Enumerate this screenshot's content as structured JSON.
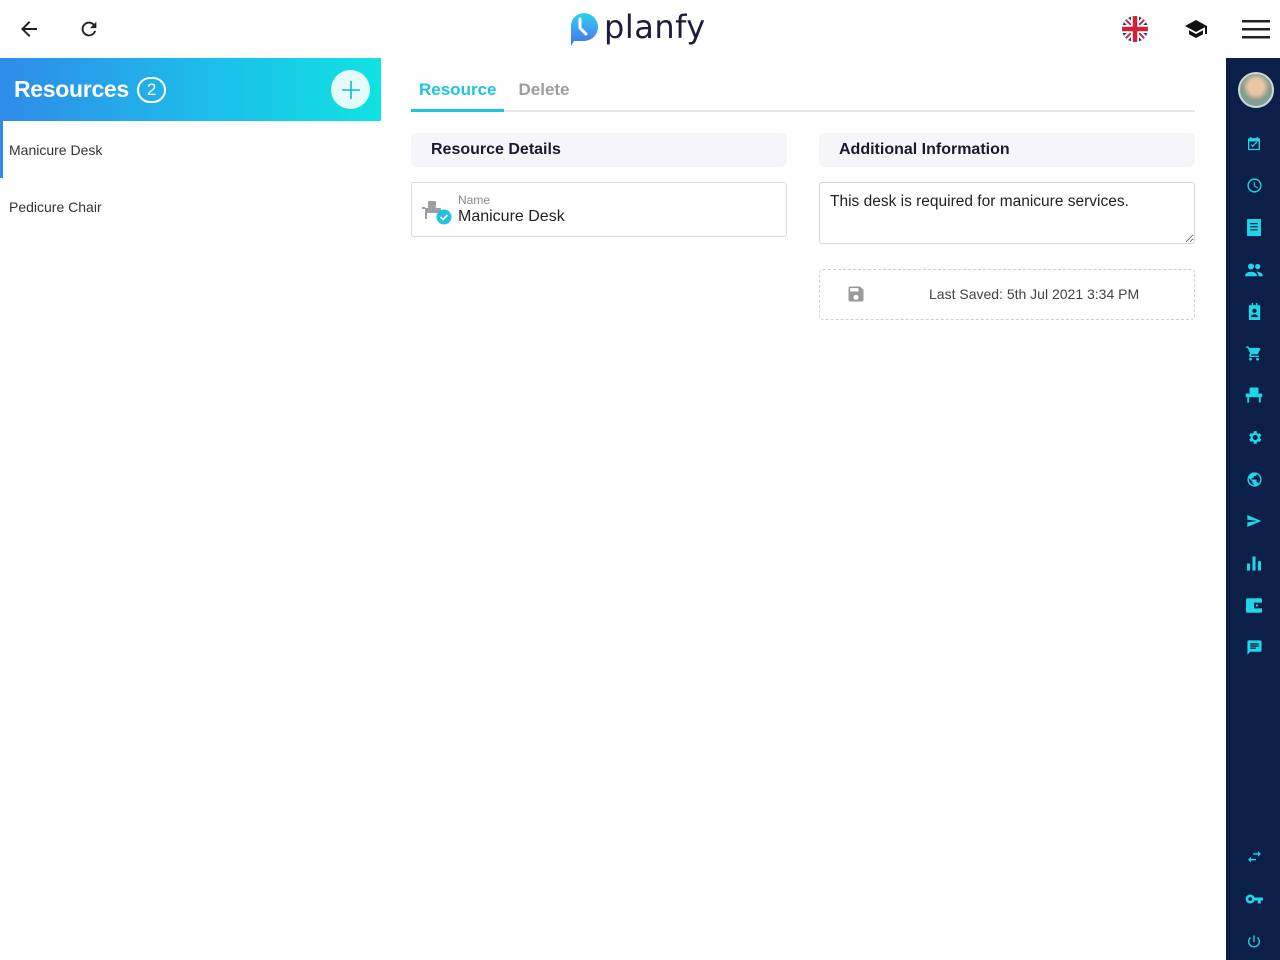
{
  "topbar": {
    "back_icon": "arrow-left-icon",
    "refresh_icon": "refresh-icon",
    "logo_text": "planfy",
    "language_icon": "uk-flag-icon",
    "tutorial_icon": "graduation-cap-icon",
    "menu_icon": "hamburger-menu-icon"
  },
  "resources": {
    "title": "Resources",
    "count": "2",
    "add_icon": "plus-icon",
    "items": [
      {
        "label": "Manicure Desk",
        "active": true
      },
      {
        "label": "Pedicure Chair",
        "active": false
      }
    ]
  },
  "main": {
    "tabs": [
      {
        "label": "Resource",
        "active": true
      },
      {
        "label": "Delete",
        "active": false
      }
    ],
    "resource_details": {
      "heading": "Resource Details",
      "name_label": "Name",
      "name_value": "Manicure Desk"
    },
    "additional_info": {
      "heading": "Additional Information",
      "notes": "This desk is required for manicure services."
    },
    "last_saved": "Last Saved: 5th Jul 2021 3:34 PM"
  },
  "right_rail": {
    "items": [
      "calendar-check-icon",
      "clock-icon",
      "receipt-icon",
      "people-icon",
      "contact-card-icon",
      "cart-icon",
      "chair-icon",
      "gear-icon",
      "globe-icon",
      "send-icon",
      "bar-chart-icon",
      "wallet-icon",
      "chat-icon"
    ],
    "bottom_items": [
      "swap-icon",
      "key-icon",
      "power-icon"
    ]
  },
  "colors": {
    "accent": "#1ec3e0",
    "rail_bg": "#0b1f48",
    "rail_icon": "#1fd6e6",
    "header_gradient_start": "#2f8be9",
    "header_gradient_end": "#10e2e2"
  }
}
